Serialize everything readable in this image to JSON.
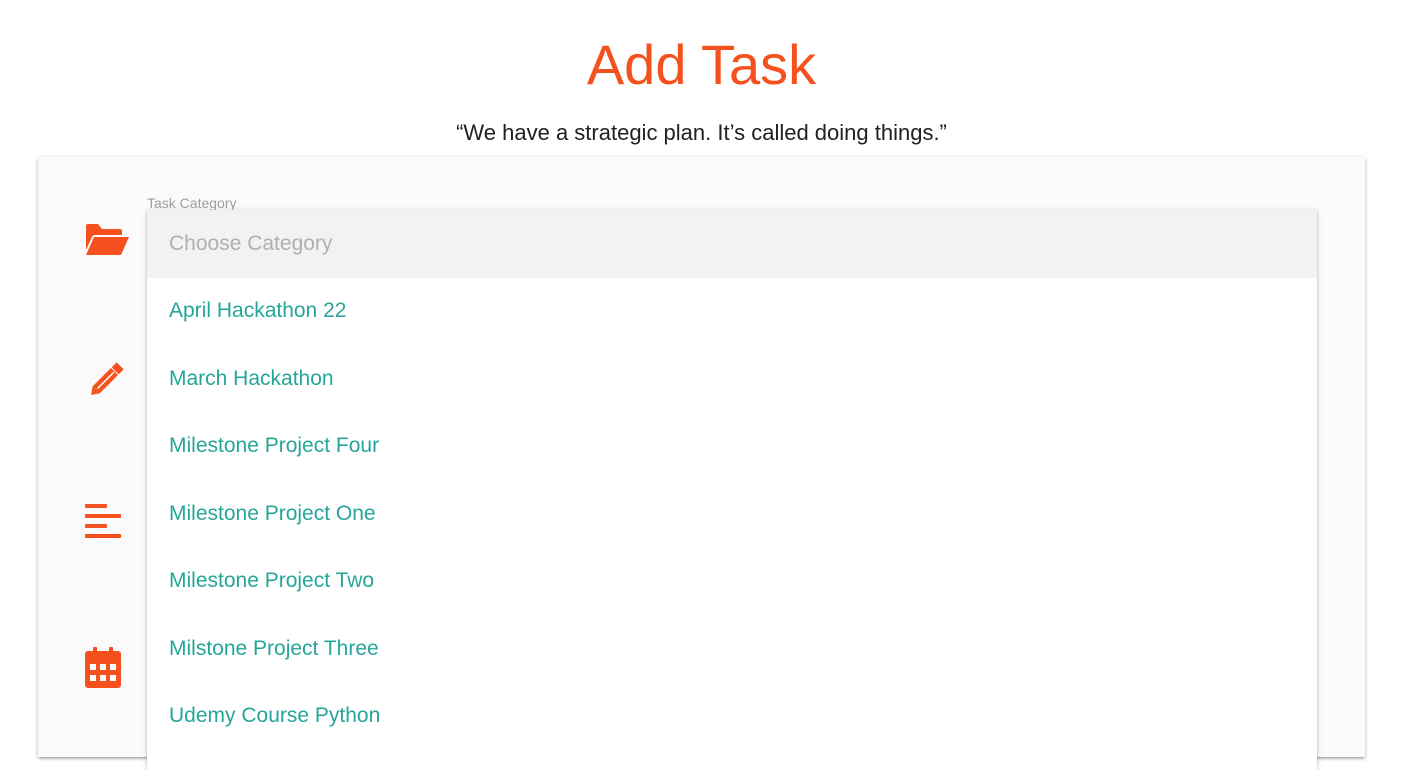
{
  "page": {
    "title": "Add Task",
    "quote": "“We have a strategic plan. It’s called doing things.”"
  },
  "form": {
    "category_label": "Task Category",
    "category_dropdown": {
      "placeholder": "Choose Category",
      "options": [
        "April Hackathon 22",
        "March Hackathon",
        "Milestone Project Four",
        "Milestone Project One",
        "Milestone Project Two",
        "Milstone Project Three",
        "Udemy Course Python"
      ]
    },
    "icons": [
      "folder-open-icon",
      "pencil-icon",
      "align-left-icon",
      "calendar-icon"
    ]
  },
  "colors": {
    "accent": "#f4511e",
    "option_text": "#26a69a",
    "card_background": "#fafafa"
  }
}
